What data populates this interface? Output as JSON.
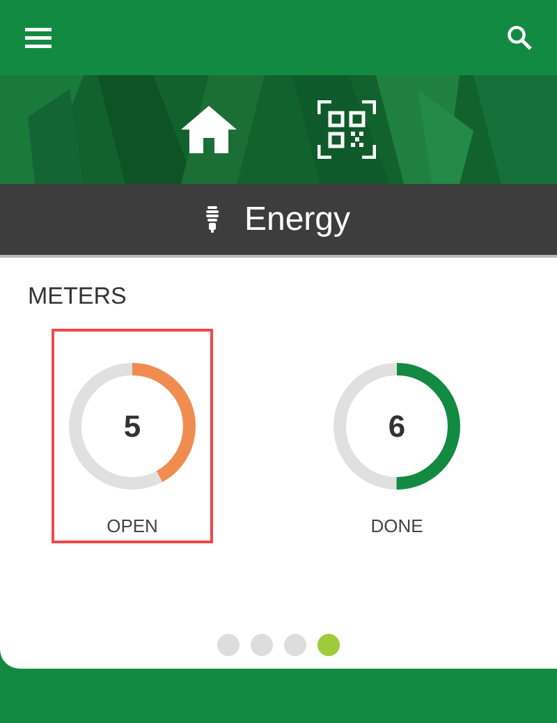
{
  "section": {
    "title": "Energy"
  },
  "meters": {
    "title": "METERS",
    "items": [
      {
        "value": "5",
        "label": "OPEN",
        "level": 0.42,
        "color": "#f08c50",
        "selected": true
      },
      {
        "value": "6",
        "label": "DONE",
        "level": 0.5,
        "color": "#138a42",
        "selected": false
      }
    ]
  },
  "pages": [
    {
      "selected": false
    },
    {
      "selected": false
    },
    {
      "selected": false
    },
    {
      "selected": true
    }
  ]
}
